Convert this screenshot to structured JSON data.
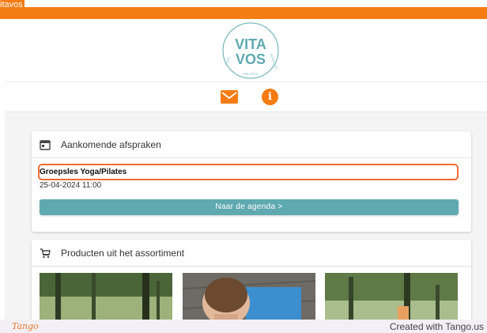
{
  "topbar": {
    "title": "itavos",
    "accent_color": "#f57c12"
  },
  "logo": {
    "line1": "VITA",
    "line2": "VOS",
    "arc_left": "YOGA",
    "arc_bottom": "PILATES",
    "arc_right": "MASSAGE",
    "color": "#5fa9b0"
  },
  "iconbar": {
    "mail_icon": "mail-icon",
    "info_icon": "info-icon",
    "info_glyph": "i"
  },
  "appointments": {
    "header": "Aankomende afspraken",
    "icon": "calendar-icon",
    "item_title": "Groepsles Yoga/Pilates",
    "item_datetime": "25-04-2024 11:00",
    "button_label": "Naar de agenda >",
    "button_color": "#5fa9b0",
    "highlight_color": "#ef6c3a"
  },
  "products": {
    "header": "Producten uit het assortiment",
    "icon": "cart-icon"
  },
  "footer": {
    "logo_text": "Tango",
    "credit": "Created with Tango.us"
  }
}
